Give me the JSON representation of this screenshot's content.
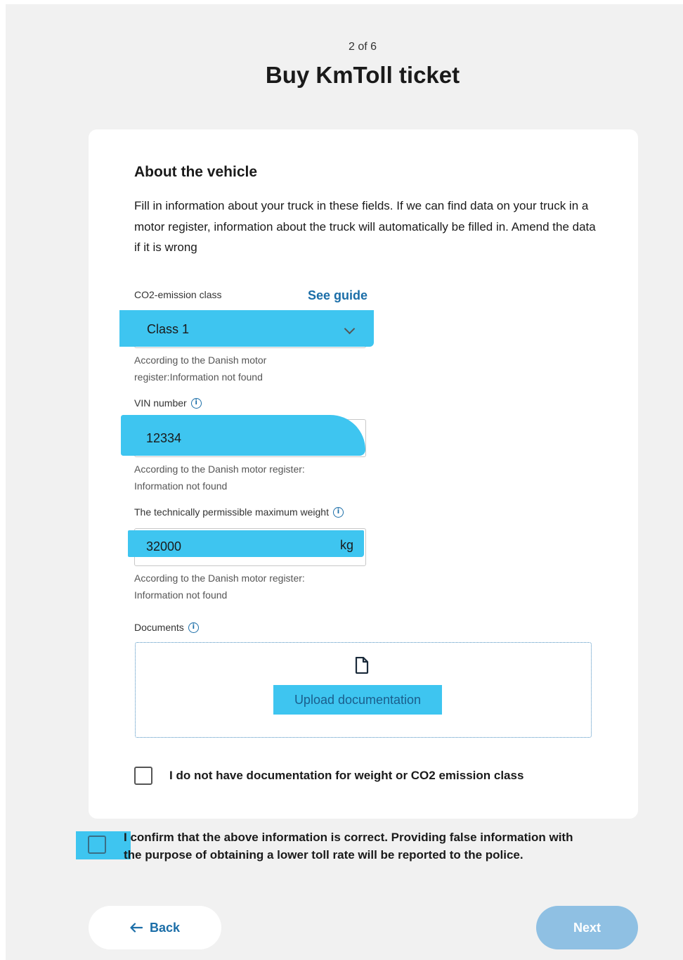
{
  "header": {
    "step": "2 of 6",
    "title": "Buy KmToll ticket"
  },
  "vehicle": {
    "section_title": "About the vehicle",
    "intro": "Fill in information about your truck in these fields. If we can find data on your truck in a motor register, information about the truck will automatically be filled in. Amend the data if it is wrong",
    "co2": {
      "label": "CO2-emission class",
      "guide_link": "See guide",
      "selected": "Class 1",
      "help_line1": "According to the Danish motor",
      "help_line2": "register:Information not found"
    },
    "vin": {
      "label": "VIN number",
      "value": "12334",
      "help_line1": "According to the Danish motor register:",
      "help_line2": "Information not found"
    },
    "weight": {
      "label": "The technically permissible maximum weight",
      "value": "32000",
      "unit": "kg",
      "help_line1": "According to the Danish motor register:",
      "help_line2": "Information not found"
    },
    "documents": {
      "label": "Documents",
      "upload_label": "Upload documentation"
    },
    "no_docs_checkbox_label": "I do not have documentation for weight or CO2 emission class"
  },
  "confirm": {
    "line1": "I confirm that the above information is correct. Providing false information with",
    "line2": "the purpose of obtaining a lower toll rate will be reported to the police."
  },
  "footer": {
    "back_label": "Back",
    "back_icon": "arrow-left-icon",
    "next_label": "Next"
  },
  "colors": {
    "accent": "#1b6ea8",
    "highlight": "#3ec5f0",
    "next_disabled": "#8fc0e3",
    "background": "#f1f1f1"
  }
}
